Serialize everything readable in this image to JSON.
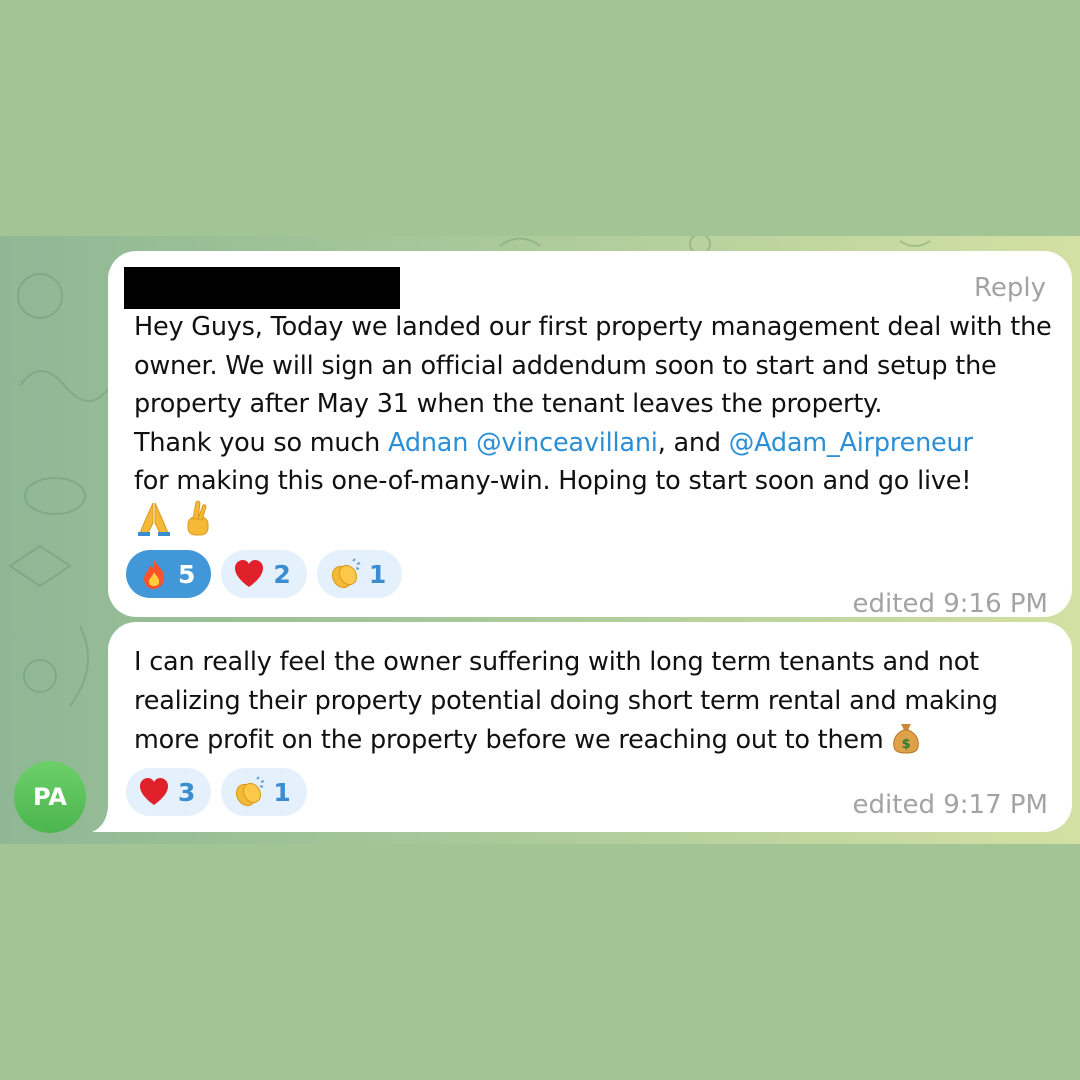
{
  "messages": [
    {
      "reply_label": "Reply",
      "text_intro": "Hey Guys, Today we landed our first property management deal with the owner. We will sign an official addendum soon to start and setup the property after May 31 when the tenant leaves the property.\nThank you so much ",
      "mention_1": "Adnan @vinceavillani",
      "text_mid": ", and ",
      "mention_2": "@Adam_Airpreneur",
      "text_end": "\nfor making this one-of-many-win. Hoping to start soon and go live!",
      "emojis": [
        "praying-hands-icon",
        "crossed-fingers-icon"
      ],
      "reactions": [
        {
          "icon": "fire-icon",
          "count": "5",
          "active": true
        },
        {
          "icon": "heart-icon",
          "count": "2",
          "active": false
        },
        {
          "icon": "clapping-hands-icon",
          "count": "1",
          "active": false
        }
      ],
      "timestamp": "edited 9:16 PM"
    },
    {
      "text": "I can really feel the owner suffering with long term tenants and not realizing their property potential doing short term rental and making more profit on the property before we reaching out to them",
      "trailing_emoji": "money-bag-icon",
      "reactions": [
        {
          "icon": "heart-icon",
          "count": "3",
          "active": false
        },
        {
          "icon": "clapping-hands-icon",
          "count": "1",
          "active": false
        }
      ],
      "timestamp": "edited 9:17 PM"
    }
  ],
  "avatar": {
    "initials": "PA"
  },
  "colors": {
    "page_bg": "#a3c495",
    "bubble_bg": "#ffffff",
    "mention": "#2b8fd6",
    "reaction_bg": "#e4f0fb",
    "reaction_active_bg": "#4197d8",
    "avatar_bg": "#56bd55",
    "meta_text": "#a3a3a3"
  }
}
